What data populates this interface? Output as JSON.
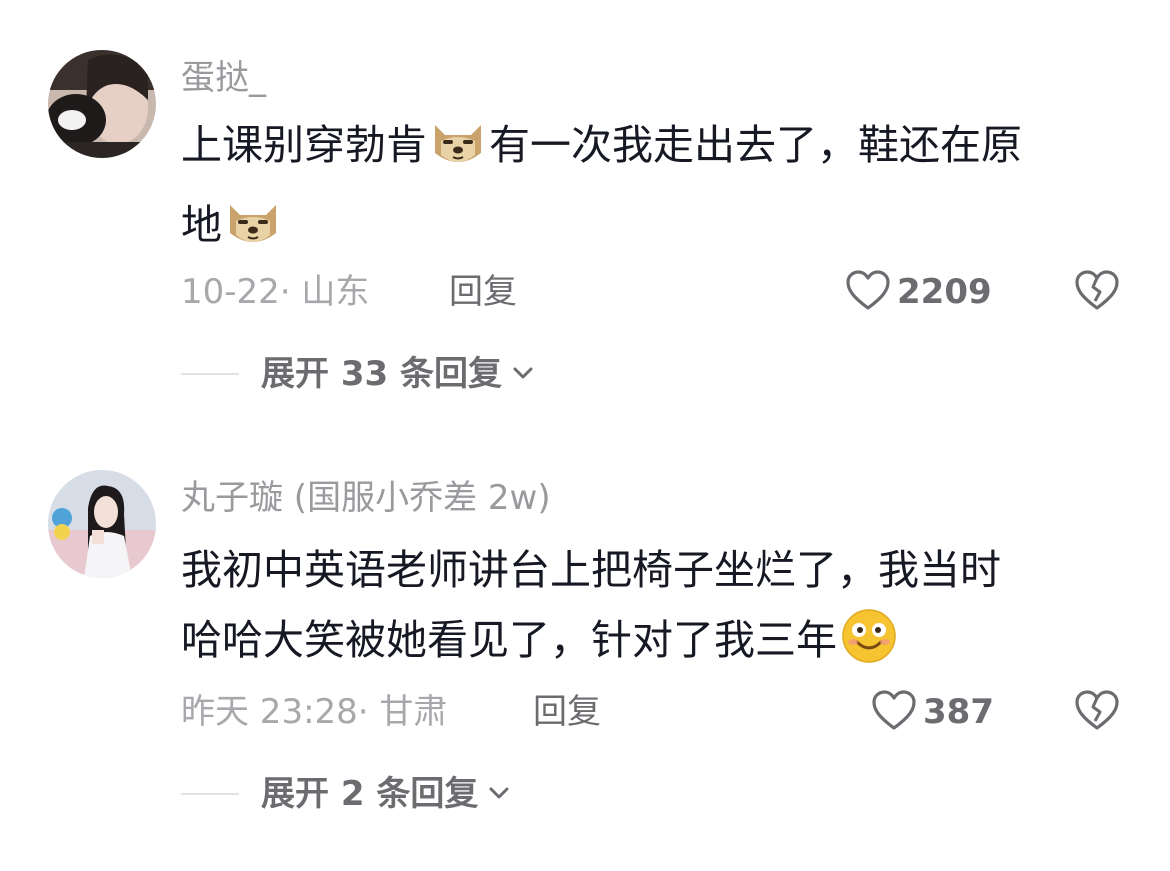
{
  "comments": [
    {
      "username": "蛋挞_",
      "content_line1_a": "上课别穿勃肯",
      "content_line1_b": "有一次我走出去了，鞋还在原",
      "content_line2": "地",
      "emoji_icon": "doge-emoji",
      "meta": "10-22· 山东",
      "reply_label": "回复",
      "likes": "2209",
      "expand_label": "展开 33 条回复"
    },
    {
      "username": "丸子璇 (国服小乔差 2w)",
      "content_line1": "我初中英语老师讲台上把椅子坐烂了，我当时",
      "content_line2": "哈哈大笑被她看见了，针对了我三年",
      "emoji_icon": "smile-emoji",
      "meta": "昨天 23:28· 甘肃",
      "reply_label": "回复",
      "likes": "387",
      "expand_label": "展开 2 条回复"
    }
  ],
  "colors": {
    "text_primary": "#161823",
    "text_secondary": "#9a9a9e",
    "icon": "#6c6c70"
  }
}
